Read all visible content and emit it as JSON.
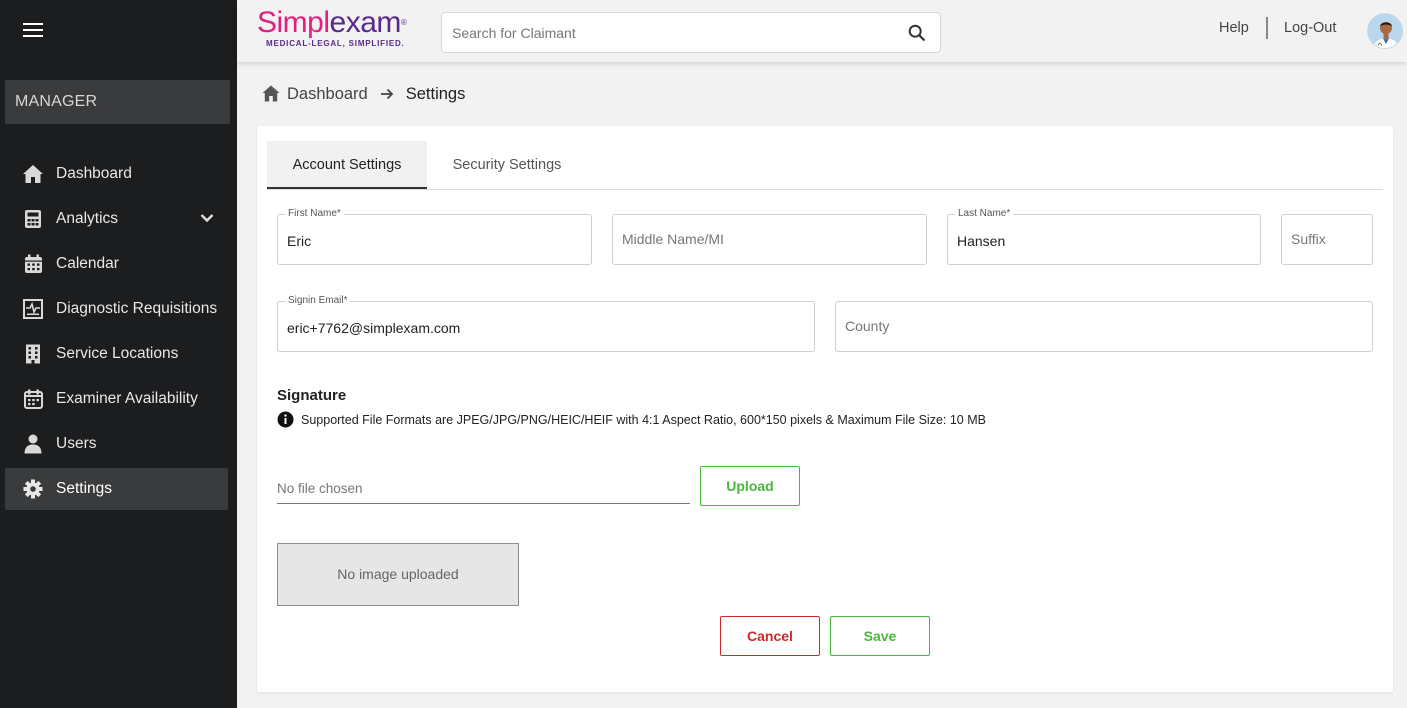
{
  "sidebar": {
    "role": "MANAGER",
    "items": [
      {
        "label": "Dashboard",
        "icon": "home-icon"
      },
      {
        "label": "Analytics",
        "icon": "calculator-icon"
      },
      {
        "label": "Calendar",
        "icon": "calendar-icon"
      },
      {
        "label": "Diagnostic Requisitions",
        "icon": "diagnostic-icon"
      },
      {
        "label": "Service Locations",
        "icon": "building-icon"
      },
      {
        "label": "Examiner Availability",
        "icon": "calendar-check-icon"
      },
      {
        "label": "Users",
        "icon": "user-icon"
      },
      {
        "label": "Settings",
        "icon": "gear-icon"
      }
    ],
    "active_item": "Settings"
  },
  "header": {
    "logo_main_1": "Simpl",
    "logo_main_2": "exam",
    "logo_trademark": "®",
    "logo_tagline": "MEDICAL-LEGAL, SIMPLIFIED.",
    "search_placeholder": "Search for Claimant",
    "help": "Help",
    "logout": "Log-Out"
  },
  "breadcrumb": {
    "home": "Dashboard",
    "current": "Settings"
  },
  "tabs": {
    "account": "Account Settings",
    "security": "Security Settings"
  },
  "form": {
    "first_name_label": "First Name*",
    "first_name_value": "Eric",
    "middle_name_placeholder": "Middle Name/MI",
    "last_name_label": "Last Name*",
    "last_name_value": "Hansen",
    "suffix_placeholder": "Suffix",
    "email_label": "Signin Email*",
    "email_value": "eric+7762@simplexam.com",
    "county_placeholder": "County"
  },
  "signature": {
    "title": "Signature",
    "info": "Supported File Formats are JPEG/JPG/PNG/HEIC/HEIF with 4:1 Aspect Ratio, 600*150 pixels & Maximum File Size: 10 MB",
    "file_status": "No file chosen",
    "upload_label": "Upload",
    "preview_text": "No image uploaded"
  },
  "actions": {
    "cancel": "Cancel",
    "save": "Save"
  },
  "colors": {
    "sidebar_bg": "#1c1d1f",
    "active_bg": "#3a3b3d",
    "brand_pink": "#e0207d",
    "brand_purple": "#5a2a8a",
    "success_green": "#4bb53f",
    "danger_red": "#cc2a2a"
  }
}
